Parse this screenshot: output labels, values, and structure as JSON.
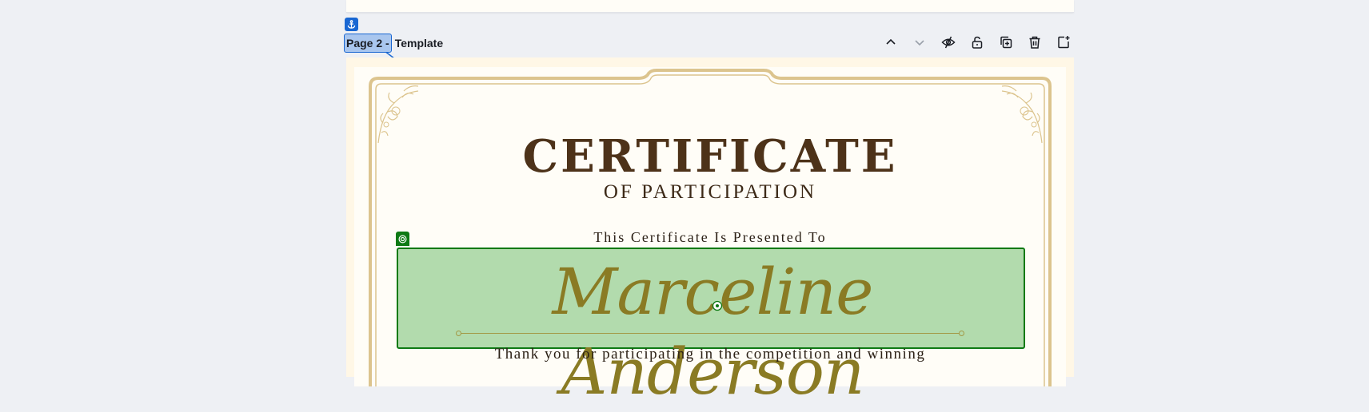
{
  "page_label": {
    "selected_text": "Page 2 -",
    "rest_text": "Template"
  },
  "toolbar": {
    "buttons": [
      {
        "name": "move-page-up-button",
        "icon": "chevron-up-icon"
      },
      {
        "name": "move-page-down-button",
        "icon": "chevron-down-icon"
      },
      {
        "name": "hide-page-button",
        "icon": "eye-slash-icon"
      },
      {
        "name": "lock-page-button",
        "icon": "lock-icon"
      },
      {
        "name": "duplicate-page-button",
        "icon": "duplicate-icon"
      },
      {
        "name": "delete-page-button",
        "icon": "trash-icon"
      },
      {
        "name": "add-page-button",
        "icon": "add-page-icon"
      }
    ]
  },
  "certificate": {
    "title": "CERTIFICATE",
    "subtitle": "OF PARTICIPATION",
    "presented_to": "This Certificate Is Presented To",
    "recipient_name": "Marceline Anderson",
    "body_text": "Thank you for participating in the competition and winning"
  },
  "colors": {
    "selection_blue": "#1967d2",
    "group_green": "#0e7a14",
    "name_fill": "#b2dbad",
    "title_brown": "#4d3219",
    "frame_gold": "#dcc48e"
  }
}
